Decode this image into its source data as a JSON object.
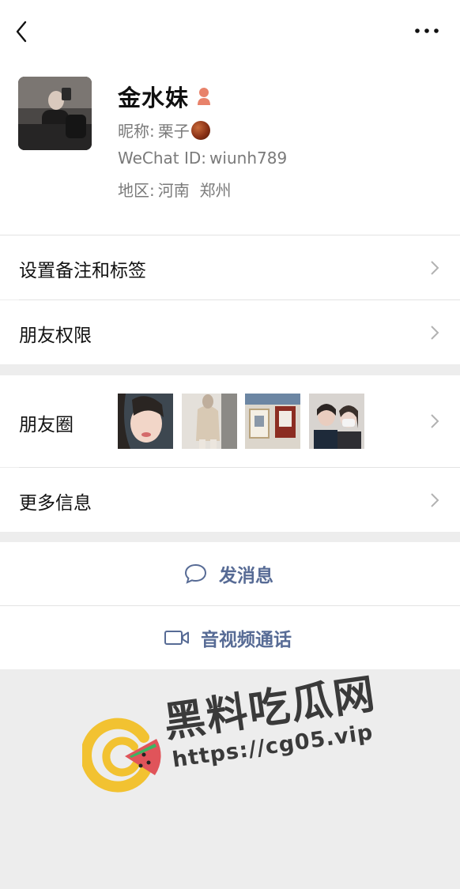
{
  "header": {
    "back_icon": "chevron-left-icon",
    "more_icon": "more-dots-icon"
  },
  "profile": {
    "name": "金水妹",
    "gender_icon": "female-person-icon",
    "nickname_label": "昵称:",
    "nickname_value": "栗子",
    "wechat_label": "WeChat ID:",
    "wechat_value": "wiunh789",
    "region_label": "地区:",
    "region_value": "河南  郑州"
  },
  "menu": {
    "remarks": "设置备注和标签",
    "permissions": "朋友权限",
    "moments": "朋友圈",
    "more_info": "更多信息"
  },
  "actions": {
    "message": "发消息",
    "message_icon": "chat-bubble-icon",
    "call": "音视频通话",
    "call_icon": "video-camera-icon"
  },
  "watermark": {
    "title": "黑料吃瓜网",
    "url": "https://cg05.vip"
  },
  "colors": {
    "link": "#576b95",
    "background": "#ededed",
    "card": "#ffffff",
    "secondary_text": "#7a7a7a",
    "gender_icon": "#e8826a"
  }
}
